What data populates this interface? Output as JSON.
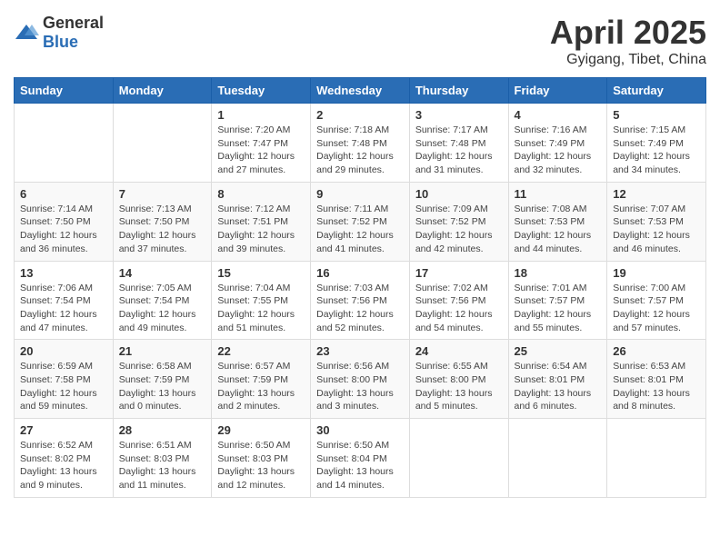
{
  "header": {
    "logo_general": "General",
    "logo_blue": "Blue",
    "title": "April 2025",
    "subtitle": "Gyigang, Tibet, China"
  },
  "weekdays": [
    "Sunday",
    "Monday",
    "Tuesday",
    "Wednesday",
    "Thursday",
    "Friday",
    "Saturday"
  ],
  "weeks": [
    [
      {
        "day": "",
        "info": ""
      },
      {
        "day": "",
        "info": ""
      },
      {
        "day": "1",
        "info": "Sunrise: 7:20 AM\nSunset: 7:47 PM\nDaylight: 12 hours and 27 minutes."
      },
      {
        "day": "2",
        "info": "Sunrise: 7:18 AM\nSunset: 7:48 PM\nDaylight: 12 hours and 29 minutes."
      },
      {
        "day": "3",
        "info": "Sunrise: 7:17 AM\nSunset: 7:48 PM\nDaylight: 12 hours and 31 minutes."
      },
      {
        "day": "4",
        "info": "Sunrise: 7:16 AM\nSunset: 7:49 PM\nDaylight: 12 hours and 32 minutes."
      },
      {
        "day": "5",
        "info": "Sunrise: 7:15 AM\nSunset: 7:49 PM\nDaylight: 12 hours and 34 minutes."
      }
    ],
    [
      {
        "day": "6",
        "info": "Sunrise: 7:14 AM\nSunset: 7:50 PM\nDaylight: 12 hours and 36 minutes."
      },
      {
        "day": "7",
        "info": "Sunrise: 7:13 AM\nSunset: 7:50 PM\nDaylight: 12 hours and 37 minutes."
      },
      {
        "day": "8",
        "info": "Sunrise: 7:12 AM\nSunset: 7:51 PM\nDaylight: 12 hours and 39 minutes."
      },
      {
        "day": "9",
        "info": "Sunrise: 7:11 AM\nSunset: 7:52 PM\nDaylight: 12 hours and 41 minutes."
      },
      {
        "day": "10",
        "info": "Sunrise: 7:09 AM\nSunset: 7:52 PM\nDaylight: 12 hours and 42 minutes."
      },
      {
        "day": "11",
        "info": "Sunrise: 7:08 AM\nSunset: 7:53 PM\nDaylight: 12 hours and 44 minutes."
      },
      {
        "day": "12",
        "info": "Sunrise: 7:07 AM\nSunset: 7:53 PM\nDaylight: 12 hours and 46 minutes."
      }
    ],
    [
      {
        "day": "13",
        "info": "Sunrise: 7:06 AM\nSunset: 7:54 PM\nDaylight: 12 hours and 47 minutes."
      },
      {
        "day": "14",
        "info": "Sunrise: 7:05 AM\nSunset: 7:54 PM\nDaylight: 12 hours and 49 minutes."
      },
      {
        "day": "15",
        "info": "Sunrise: 7:04 AM\nSunset: 7:55 PM\nDaylight: 12 hours and 51 minutes."
      },
      {
        "day": "16",
        "info": "Sunrise: 7:03 AM\nSunset: 7:56 PM\nDaylight: 12 hours and 52 minutes."
      },
      {
        "day": "17",
        "info": "Sunrise: 7:02 AM\nSunset: 7:56 PM\nDaylight: 12 hours and 54 minutes."
      },
      {
        "day": "18",
        "info": "Sunrise: 7:01 AM\nSunset: 7:57 PM\nDaylight: 12 hours and 55 minutes."
      },
      {
        "day": "19",
        "info": "Sunrise: 7:00 AM\nSunset: 7:57 PM\nDaylight: 12 hours and 57 minutes."
      }
    ],
    [
      {
        "day": "20",
        "info": "Sunrise: 6:59 AM\nSunset: 7:58 PM\nDaylight: 12 hours and 59 minutes."
      },
      {
        "day": "21",
        "info": "Sunrise: 6:58 AM\nSunset: 7:59 PM\nDaylight: 13 hours and 0 minutes."
      },
      {
        "day": "22",
        "info": "Sunrise: 6:57 AM\nSunset: 7:59 PM\nDaylight: 13 hours and 2 minutes."
      },
      {
        "day": "23",
        "info": "Sunrise: 6:56 AM\nSunset: 8:00 PM\nDaylight: 13 hours and 3 minutes."
      },
      {
        "day": "24",
        "info": "Sunrise: 6:55 AM\nSunset: 8:00 PM\nDaylight: 13 hours and 5 minutes."
      },
      {
        "day": "25",
        "info": "Sunrise: 6:54 AM\nSunset: 8:01 PM\nDaylight: 13 hours and 6 minutes."
      },
      {
        "day": "26",
        "info": "Sunrise: 6:53 AM\nSunset: 8:01 PM\nDaylight: 13 hours and 8 minutes."
      }
    ],
    [
      {
        "day": "27",
        "info": "Sunrise: 6:52 AM\nSunset: 8:02 PM\nDaylight: 13 hours and 9 minutes."
      },
      {
        "day": "28",
        "info": "Sunrise: 6:51 AM\nSunset: 8:03 PM\nDaylight: 13 hours and 11 minutes."
      },
      {
        "day": "29",
        "info": "Sunrise: 6:50 AM\nSunset: 8:03 PM\nDaylight: 13 hours and 12 minutes."
      },
      {
        "day": "30",
        "info": "Sunrise: 6:50 AM\nSunset: 8:04 PM\nDaylight: 13 hours and 14 minutes."
      },
      {
        "day": "",
        "info": ""
      },
      {
        "day": "",
        "info": ""
      },
      {
        "day": "",
        "info": ""
      }
    ]
  ]
}
